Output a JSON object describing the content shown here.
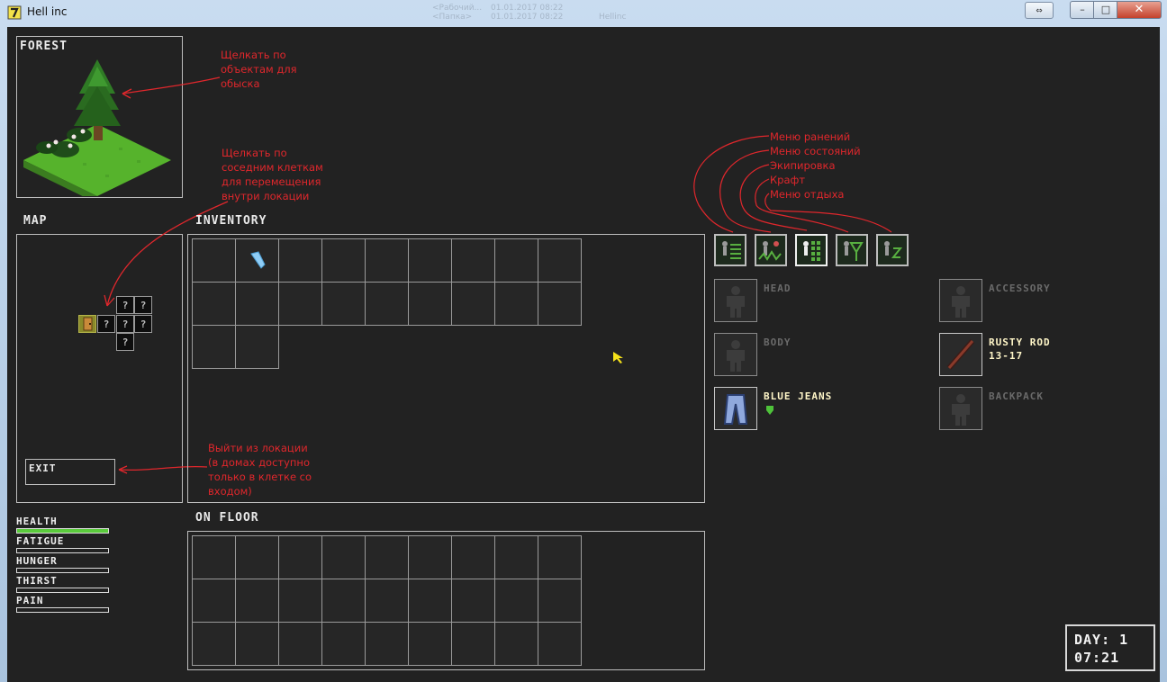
{
  "window": {
    "title": "Hell inc",
    "snap_icon": "⇔",
    "minimize_label": "–",
    "maximize_label": "□",
    "close_label": "✕"
  },
  "background_window": {
    "row1_col1": "<Рабочий...",
    "row1_col2": "01.01.2017 08:22",
    "row2_col1": "<Папка>",
    "row2_col2": "01.01.2017 08:22",
    "row2_col3": "Hellinc"
  },
  "location": {
    "title": "FOREST",
    "annotation": [
      "Щелкать по",
      "объектам для",
      "обыска"
    ]
  },
  "map": {
    "title": "MAP",
    "unknown_glyph": "?",
    "annotation": [
      "Щелкать по",
      "соседним клеткам",
      "для перемещения",
      "внутри локации"
    ]
  },
  "exit": {
    "label": "EXIT",
    "annotation": [
      "Выйти из локации",
      "(в домах доступно",
      "только в клетке со",
      "входом)"
    ]
  },
  "inventory": {
    "title": "INVENTORY",
    "items": [
      {
        "slot": 1,
        "name": "blue-crystal"
      }
    ]
  },
  "floor": {
    "title": "ON FLOOR"
  },
  "menus": {
    "annotations": [
      "Меню ранений",
      "Меню состояний",
      "Экипировка",
      "Крафт",
      "Меню отдыха"
    ],
    "tabs": [
      "wounds-icon",
      "states-icon",
      "equipment-icon",
      "craft-icon",
      "rest-icon"
    ],
    "active_tab": 2
  },
  "equipment": {
    "head": {
      "label": "HEAD"
    },
    "body": {
      "label": "BODY"
    },
    "legs": {
      "label": "BLUE JEANS"
    },
    "accessory": {
      "label": "ACCESSORY"
    },
    "weapon": {
      "label": "RUSTY ROD",
      "stat": "13-17"
    },
    "backpack": {
      "label": "BACKPACK"
    }
  },
  "stats": {
    "health": {
      "label": "HEALTH",
      "value": 1.0
    },
    "fatigue": {
      "label": "FATIGUE",
      "value": 0
    },
    "hunger": {
      "label": "HUNGER",
      "value": 0
    },
    "thirst": {
      "label": "THIRST",
      "value": 0
    },
    "pain": {
      "label": "PAIN",
      "value": 0
    }
  },
  "time": {
    "day": "DAY: 1",
    "clock": "07:21"
  },
  "colors": {
    "annotation": "#e0272c",
    "background": "#222222",
    "health": "#5acb3c",
    "highlight_text": "#fff6c8"
  }
}
